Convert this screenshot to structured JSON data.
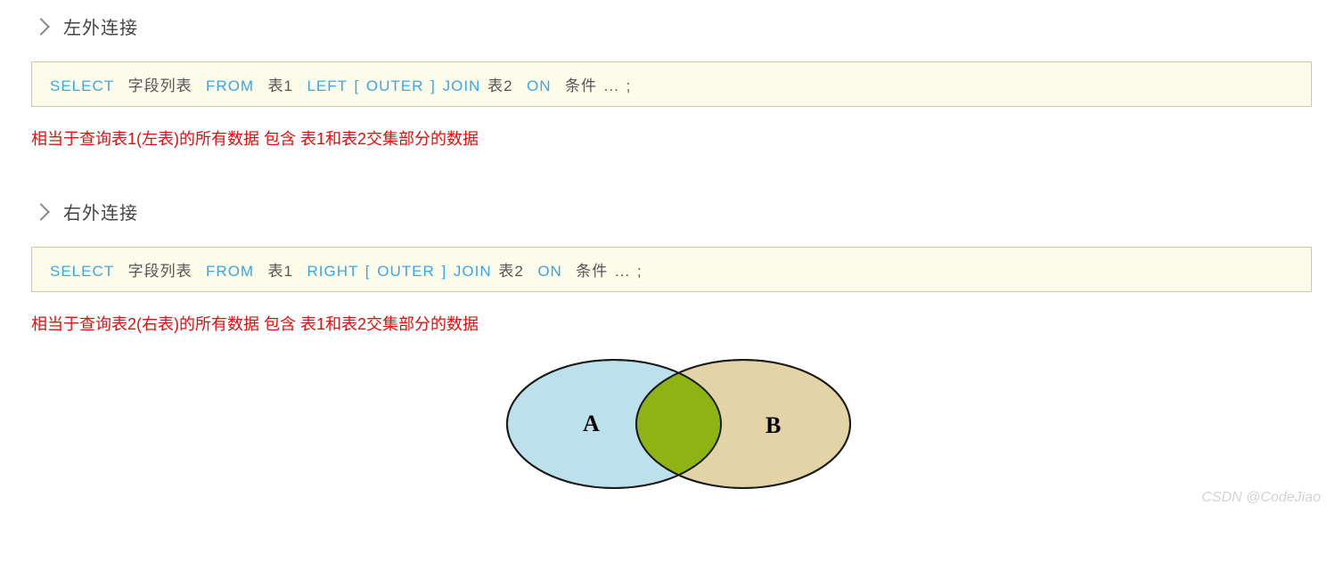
{
  "sections": [
    {
      "heading": "左外连接",
      "code": {
        "kw1": "SELECT",
        "p1": "字段列表",
        "kw2": "FROM",
        "p2": "表1",
        "kw3": "LEFT",
        "kw4": "[ OUTER ]",
        "kw5": "JOIN",
        "p3": "表2",
        "kw6": "ON",
        "p4": "条件 ... ;"
      },
      "description": "相当于查询表1(左表)的所有数据 包含 表1和表2交集部分的数据"
    },
    {
      "heading": "右外连接",
      "code": {
        "kw1": "SELECT",
        "p1": "字段列表",
        "kw2": "FROM",
        "p2": "表1",
        "kw3": "RIGHT",
        "kw4": "[ OUTER ]",
        "kw5": "JOIN",
        "p3": "表2",
        "kw6": "ON",
        "p4": "条件 ... ;"
      },
      "description": "相当于查询表2(右表)的所有数据 包含 表1和表2交集部分的数据"
    }
  ],
  "venn": {
    "labelA": "A",
    "labelB": "B",
    "colorA": "#bde1ec",
    "colorB": "#e3d4a8",
    "colorIntersect": "#8eb414"
  },
  "watermark": "CSDN @CodeJiao"
}
